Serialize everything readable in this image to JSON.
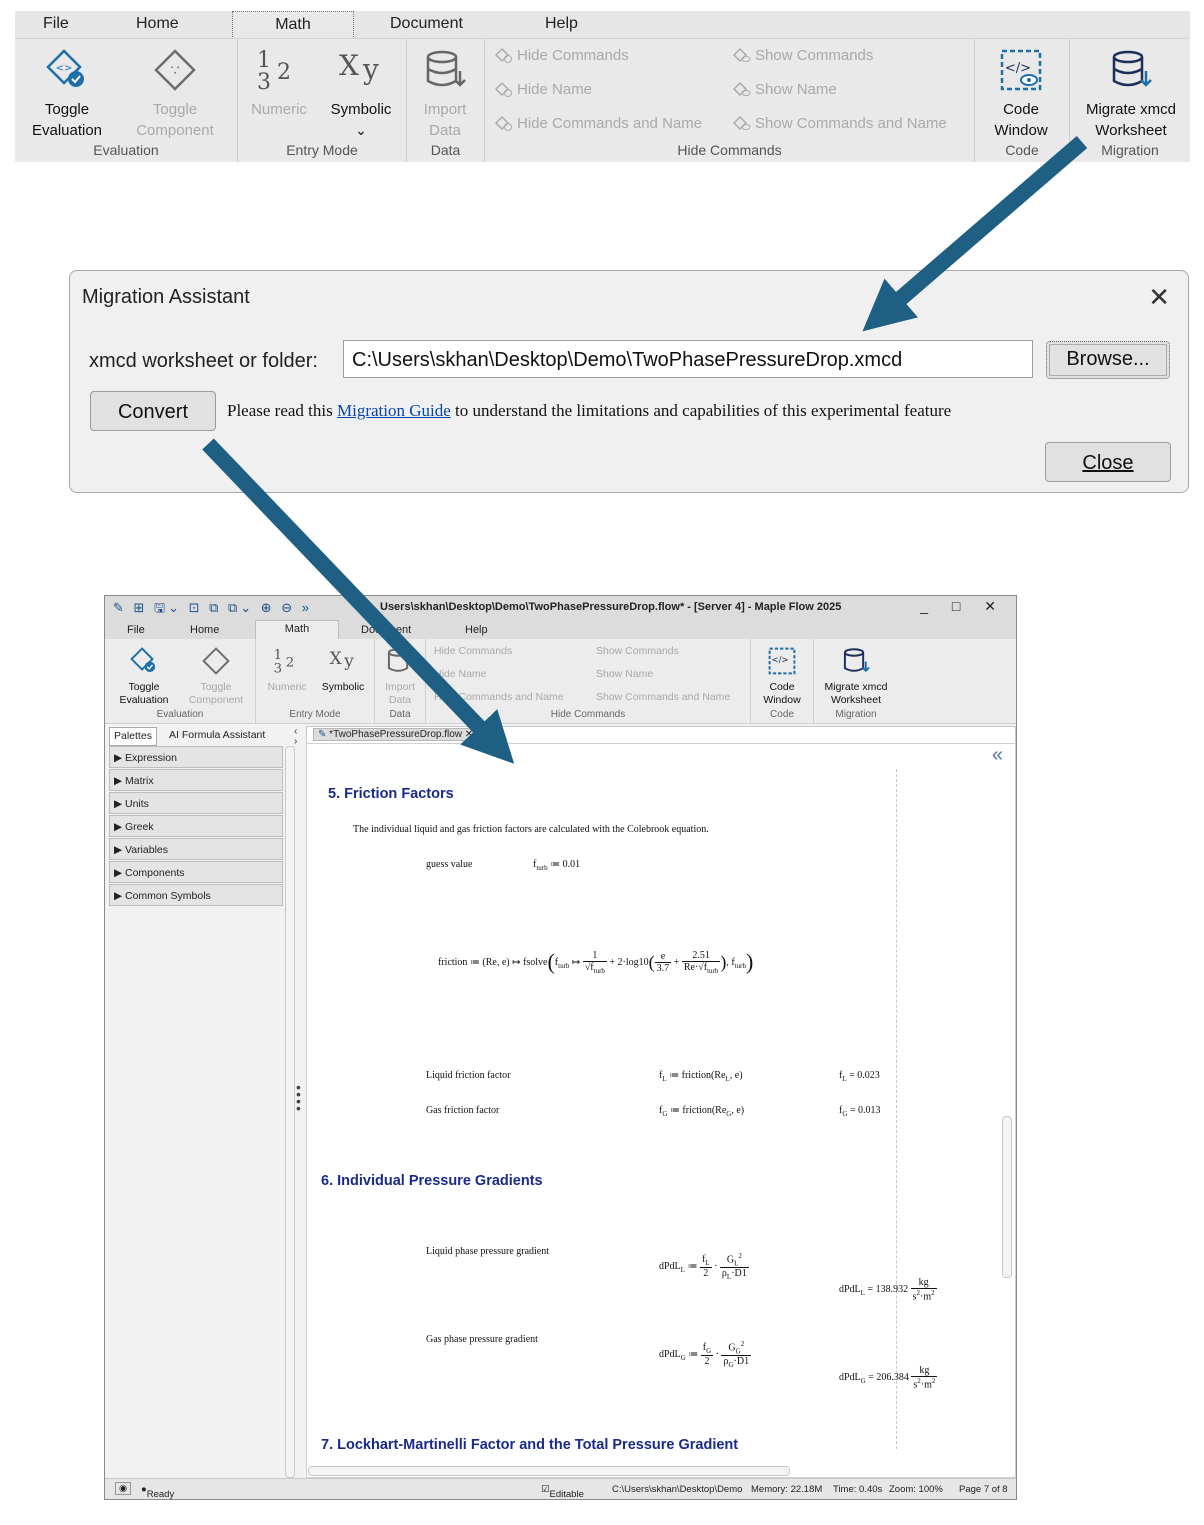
{
  "ribbon": {
    "tabs": [
      "File",
      "Home",
      "Math",
      "Document",
      "Help"
    ],
    "active_tab": "Math",
    "groups": {
      "evaluation": "Evaluation",
      "entry_mode": "Entry Mode",
      "data": "Data",
      "hide_commands": "Hide Commands",
      "code": "Code",
      "migration": "Migration"
    },
    "buttons": {
      "toggle_evaluation_1": "Toggle",
      "toggle_evaluation_2": "Evaluation",
      "toggle_component_1": "Toggle",
      "toggle_component_2": "Component",
      "numeric": "Numeric",
      "symbolic": "Symbolic",
      "import_data_1": "Import",
      "import_data_2": "Data",
      "code_window_1": "Code",
      "code_window_2": "Window",
      "migrate_1": "Migrate xmcd",
      "migrate_2": "Worksheet"
    },
    "commands": {
      "hide_commands": "Hide Commands",
      "hide_name": "Hide Name",
      "hide_commands_and_name": "Hide Commands and Name",
      "show_commands": "Show Commands",
      "show_name": "Show Name",
      "show_commands_and_name": "Show Commands and Name"
    },
    "numeric_glyph": "1₃2",
    "symbolic_glyph": "Xy"
  },
  "dialog": {
    "title": "Migration Assistant",
    "close_icon": "✕",
    "field_label": "xmcd worksheet or folder:",
    "path_value": "C:\\Users\\skhan\\Desktop\\Demo\\TwoPhasePressureDrop.xmcd",
    "browse_label": "Browse...",
    "convert_label": "Convert",
    "note_before": "Please read this ",
    "note_link": "Migration Guide",
    "note_after": " to understand the limitations and capabilities of this experimental feature",
    "close_label": "Close"
  },
  "app": {
    "title": "Users\\skhan\\Desktop\\Demo\\TwoPhasePressureDrop.flow* - [Server 4] - Maple Flow 2025",
    "window_controls": "_ □ ✕",
    "tabs": [
      "File",
      "Home",
      "Math",
      "Document",
      "Help"
    ],
    "palette_tabs": [
      "Palettes",
      "AI Formula Assistant"
    ],
    "palettes": [
      "Expression",
      "Matrix",
      "Units",
      "Greek",
      "Variables",
      "Components",
      "Common Symbols"
    ],
    "doc_tab": "*TwoPhasePressureDrop.flow",
    "status": {
      "ready": "Ready",
      "editable": "Editable",
      "path": "C:\\Users\\skhan\\Desktop\\Demo",
      "memory": "Memory: 22.18M",
      "time": "Time: 0.40s",
      "zoom": "Zoom: 100%",
      "page": "Page 7 of 8"
    }
  },
  "document": {
    "h5": "5. Friction Factors",
    "p5": "The individual liquid and gas friction factors are calculated with the Colebrook equation.",
    "guess_label": "guess value",
    "guess_math": "0.01",
    "liquid_ff_label": "Liquid friction factor",
    "gas_ff_label": "Gas friction factor",
    "fL_result": "0.023",
    "fG_result": "0.013",
    "h6": "6. Individual Pressure Gradients",
    "liquid_pg_label": "Liquid phase pressure gradient",
    "gas_pg_label": "Gas phase pressure gradient",
    "dPdL_L_result": "138.932",
    "dPdL_G_result": "206.384",
    "h7": "7. Lockhart-Martinelli Factor and the Total Pressure Gradient"
  },
  "colors": {
    "arrow": "#1f5f84",
    "heading": "#1a2a8a",
    "link": "#0645ad"
  }
}
